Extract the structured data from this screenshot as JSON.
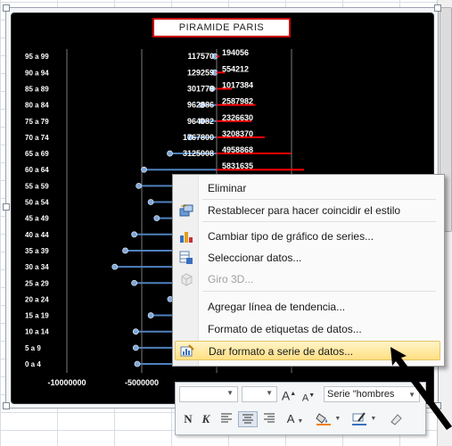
{
  "chart": {
    "title": "PIRAMIDE   PARIS"
  },
  "chart_data": {
    "type": "bar",
    "title": "PIRAMIDE   PARIS",
    "categories": [
      "0 a 4",
      "5 a 9",
      "10 a 14",
      "15 a 19",
      "20 a 24",
      "25 a 29",
      "30 a 34",
      "35 a 39",
      "40 a 44",
      "45 a 49",
      "50 a 54",
      "55 a 59",
      "60 a 64",
      "65 a 69",
      "70 a 74",
      "75 a 79",
      "80 a 84",
      "85 a 89",
      "90 a 94",
      "95 a 99"
    ],
    "series": [
      {
        "values": [
          -5300000,
          -5400000,
          -5400000,
          -4400000,
          -3100000,
          -5500000,
          -6800000,
          -6100000,
          -5500000,
          -4000000,
          -4400000,
          -5200000,
          -4850000,
          -3125008,
          -1767800,
          -964082,
          -962886,
          -301779,
          -129259,
          -117570
        ]
      },
      {
        "values": [
          null,
          null,
          null,
          null,
          null,
          null,
          null,
          null,
          null,
          null,
          null,
          null,
          5831635,
          4958868,
          3208370,
          2326630,
          2587982,
          1017384,
          554212,
          194056
        ]
      }
    ],
    "visible_data_labels": {
      "left": [
        "117570",
        "129259",
        "301779",
        "962886",
        "964082",
        "1767800",
        "3125008"
      ],
      "right": [
        "194056",
        "554212",
        "1017384",
        "2587982",
        "2326630",
        "3208370",
        "4958868",
        "5831635"
      ]
    },
    "x_tick_labels": [
      "-10000000",
      "-5000000"
    ],
    "grid": true
  },
  "context_menu": {
    "items": [
      {
        "label": "Eliminar",
        "icon": "none",
        "disabled": false
      },
      {
        "label": "Restablecer para hacer coincidir el estilo",
        "icon": "reset-style-icon",
        "disabled": false
      },
      {
        "label": "Cambiar tipo de gráfico de series...",
        "icon": "chart-type-icon",
        "disabled": false
      },
      {
        "label": "Seleccionar datos...",
        "icon": "select-data-icon",
        "disabled": false
      },
      {
        "label": "Giro 3D...",
        "icon": "rotate-3d-icon",
        "disabled": true
      },
      {
        "label": "Agregar línea de tendencia...",
        "icon": "none",
        "disabled": false
      },
      {
        "label": "Formato de etiquetas de datos...",
        "icon": "none",
        "disabled": false
      },
      {
        "label": "Dar formato a serie de datos...",
        "icon": "format-series-icon",
        "disabled": false,
        "highlighted": true
      }
    ]
  },
  "mini_toolbar": {
    "series_selector": "Serie \"hombres",
    "grow_font": "A",
    "shrink_font": "A",
    "bold": "N",
    "italic": "K",
    "font_color": "A"
  },
  "colors": {
    "plot_bg": "#000000",
    "men_series": "#4f81bd",
    "women_series": "#ff0000",
    "menu_highlight": "#ffe083"
  }
}
